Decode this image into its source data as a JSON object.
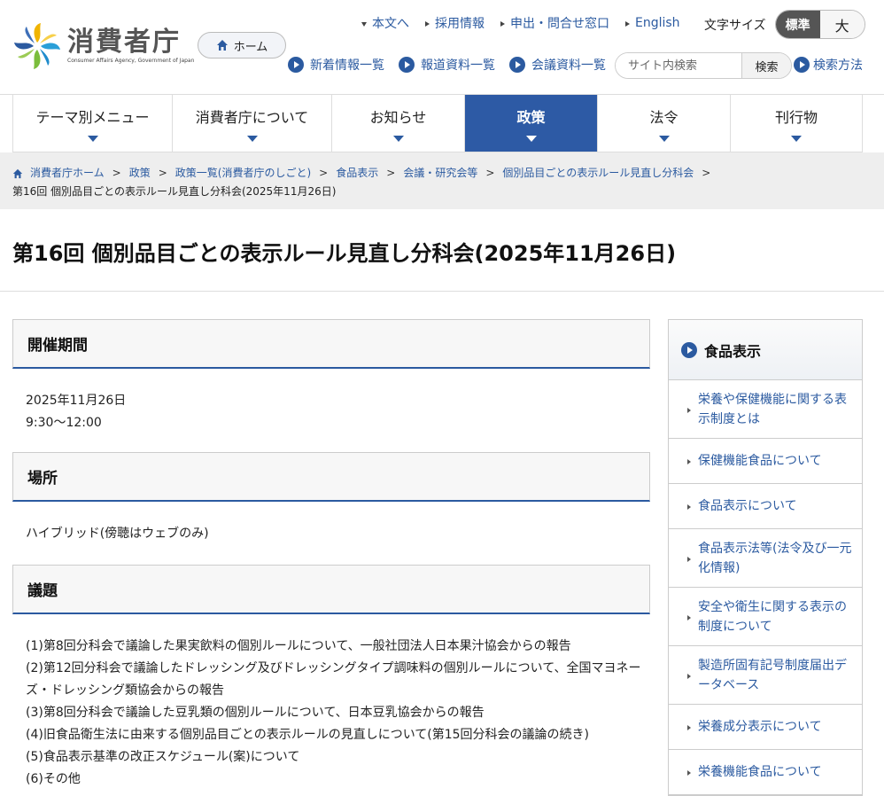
{
  "header": {
    "logo_title": "消費者庁",
    "logo_subtitle": "Consumer Affairs Agency, Government of Japan",
    "home_label": "ホーム",
    "top_links": [
      {
        "label": "本文へ"
      },
      {
        "label": "採用情報"
      },
      {
        "label": "申出・問合せ窓口"
      },
      {
        "label": "English"
      }
    ],
    "font_size_label": "文字サイズ",
    "font_size_standard": "標準",
    "font_size_large": "大",
    "sub_links": [
      {
        "label": "新着情報一覧"
      },
      {
        "label": "報道資料一覧"
      },
      {
        "label": "会議資料一覧"
      }
    ],
    "search_placeholder": "サイト内検索",
    "search_button": "検索",
    "search_help": "検索方法"
  },
  "nav": [
    {
      "label": "テーマ別メニュー",
      "active": false
    },
    {
      "label": "消費者庁について",
      "active": false
    },
    {
      "label": "お知らせ",
      "active": false
    },
    {
      "label": "政策",
      "active": true
    },
    {
      "label": "法令",
      "active": false
    },
    {
      "label": "刊行物",
      "active": false
    }
  ],
  "breadcrumb": {
    "items": [
      "消費者庁ホーム",
      "政策",
      "政策一覧(消費者庁のしごと)",
      "食品表示",
      "会議・研究会等",
      "個別品目ごとの表示ルール見直し分科会"
    ],
    "current": "第16回 個別品目ごとの表示ルール見直し分科会(2025年11月26日)"
  },
  "page_title": "第16回 個別品目ごとの表示ルール見直し分科会(2025年11月26日)",
  "sections": {
    "period": {
      "heading": "開催期間",
      "date": "2025年11月26日",
      "time": "9:30〜12:00"
    },
    "place": {
      "heading": "場所",
      "text": "ハイブリッド(傍聴はウェブのみ)"
    },
    "agenda": {
      "heading": "議題",
      "lines": [
        "(1)第8回分科会で議論した果実飲料の個別ルールについて、一般社団法人日本果汁協会からの報告",
        "(2)第12回分科会で議論したドレッシング及びドレッシングタイプ調味料の個別ルールについて、全国マヨネー",
        "ズ・ドレッシング類協会からの報告",
        "(3)第8回分科会で議論した豆乳類の個別ルールについて、日本豆乳協会からの報告",
        "(4)旧食品衛生法に由来する個別品目ごとの表示ルールの見直しについて(第15回分科会の議論の続き)",
        "(5)食品表示基準の改正スケジュール(案)について",
        "(6)その他"
      ]
    }
  },
  "sidebar": {
    "heading": "食品表示",
    "items": [
      {
        "line1": "栄養や保健機能に関する表",
        "line2": "示制度とは"
      },
      {
        "line1": "保健機能食品について",
        "line2": ""
      },
      {
        "line1": "食品表示について",
        "line2": ""
      },
      {
        "line1": "食品表示法等(法令及び一元",
        "line2": "化情報)"
      },
      {
        "line1": "安全や衛生に関する表示の",
        "line2": "制度について"
      },
      {
        "line1": "製造所固有記号制度届出デ",
        "line2": "ータベース"
      },
      {
        "line1": "栄養成分表示について",
        "line2": ""
      },
      {
        "line1": "栄養機能食品について",
        "line2": ""
      }
    ]
  }
}
